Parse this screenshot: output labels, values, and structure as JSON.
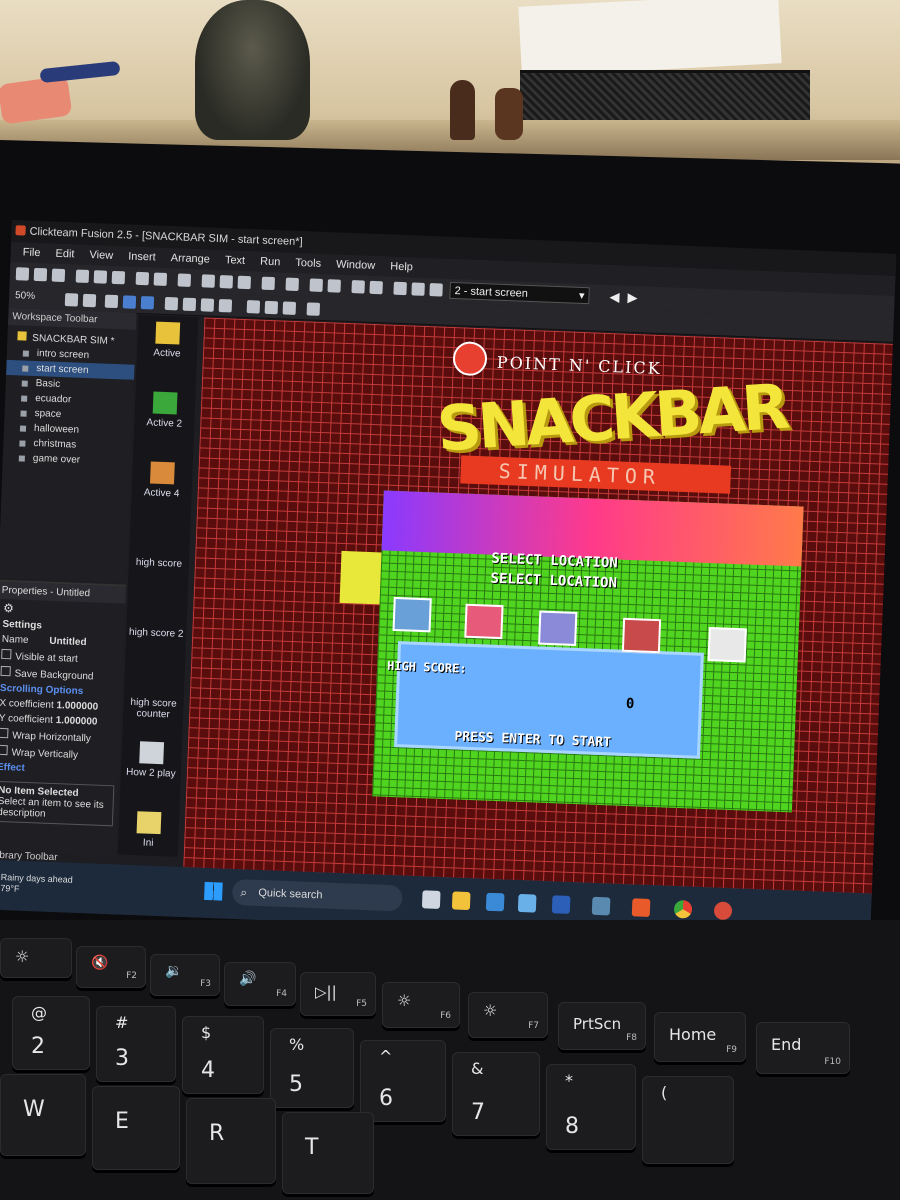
{
  "app": {
    "title": "Clickteam Fusion 2.5 - [SNACKBAR SIM - start screen*]",
    "menu": [
      "File",
      "Edit",
      "View",
      "Insert",
      "Arrange",
      "Text",
      "Run",
      "Tools",
      "Window",
      "Help"
    ],
    "zoom": "50%",
    "frame_selector": "2 - start screen"
  },
  "workspace": {
    "header": "Workspace Toolbar",
    "project": "SNACKBAR SIM *",
    "frames": [
      "intro screen",
      "start screen",
      "Basic",
      "ecuador",
      "space",
      "halloween",
      "christmas",
      "game over"
    ],
    "selected_frame": "start screen"
  },
  "properties": {
    "header": "Properties - Untitled",
    "settings_label": "Settings",
    "name_label": "Name",
    "name_value": "Untitled",
    "visible_at_start": "Visible at start",
    "save_background": "Save Background",
    "scrolling_options": "Scrolling Options",
    "x_coef_label": "X coefficient",
    "x_coef_value": "1.000000",
    "y_coef_label": "Y coefficient",
    "y_coef_value": "1.000000",
    "wrap_h": "Wrap Horizontally",
    "wrap_v": "Wrap Vertically",
    "effect": "Effect",
    "no_item_title": "No Item Selected",
    "no_item_desc": "Select an item to see its description",
    "library": "Library Toolbar"
  },
  "objects": [
    "Active",
    "Active 2",
    "Active 4",
    "high score",
    "high score 2",
    "high score counter",
    "How 2 play",
    "Ini"
  ],
  "game": {
    "logo_top": "POINT N' CLICK",
    "logo_main": "SNACKBAR",
    "logo_sub": "SIMULATOR",
    "select_1": "SELECT LOCATION",
    "select_2": "SELECT LOCATION",
    "high_score_label": "HIGH SCORE:",
    "high_score_value": "0",
    "press_enter": "PRESS ENTER TO START"
  },
  "taskbar": {
    "weather_line1": "Rainy days ahead",
    "weather_line2": "79°F",
    "search": "Quick search"
  },
  "keyboard": {
    "fn_row": [
      {
        "icon": "☼",
        "sub": ""
      },
      {
        "icon": "🔇",
        "sub": "F2"
      },
      {
        "icon": "🔉",
        "sub": "F3"
      },
      {
        "icon": "🔊",
        "sub": "F4"
      },
      {
        "icon": "▷||",
        "sub": "F5"
      },
      {
        "icon": "☼",
        "sub": "F6"
      },
      {
        "icon": "☼",
        "sub": "F7"
      },
      {
        "icon": "PrtScn",
        "sub": "F8"
      },
      {
        "icon": "Home",
        "sub": "F9"
      },
      {
        "icon": "End",
        "sub": "F10"
      }
    ],
    "number_row": [
      {
        "top": "@",
        "bot": "2"
      },
      {
        "top": "#",
        "bot": "3"
      },
      {
        "top": "$",
        "bot": "4"
      },
      {
        "top": "%",
        "bot": "5"
      },
      {
        "top": "^",
        "bot": "6"
      },
      {
        "top": "&",
        "bot": "7"
      },
      {
        "top": "*",
        "bot": "8"
      },
      {
        "top": "(",
        "bot": ""
      }
    ],
    "letter_row": [
      "W",
      "E",
      "R",
      "T"
    ]
  }
}
